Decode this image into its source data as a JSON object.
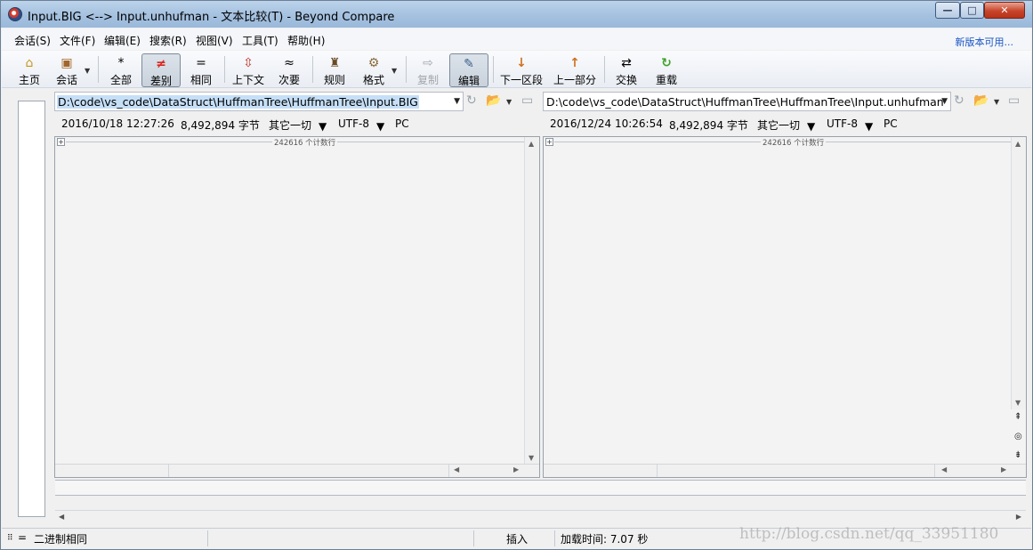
{
  "window": {
    "title": "Input.BIG <--> Input.unhufman - 文本比较(T) - Beyond Compare",
    "buttons": {
      "minimize": "—",
      "maximize": "□",
      "close": "✕"
    }
  },
  "menu": {
    "items": [
      "会话(S)",
      "文件(F)",
      "编辑(E)",
      "搜索(R)",
      "视图(V)",
      "工具(T)",
      "帮助(H)"
    ],
    "new_version": "新版本可用..."
  },
  "toolbar": {
    "home": "主页",
    "session": "会话",
    "all": "全部",
    "diff": "差别",
    "same": "相同",
    "context": "上下文",
    "minor": "次要",
    "rules": "规则",
    "format": "格式",
    "copy": "复制",
    "edit": "编辑",
    "next_section": "下一区段",
    "prev_section": "上一部分",
    "swap": "交换",
    "reload": "重载"
  },
  "left": {
    "path": "D:\\code\\vs_code\\DataStruct\\HuffmanTree\\HuffmanTree\\Input.BIG",
    "date": "2016/10/18 12:27:26",
    "size": "8,492,894 字节",
    "filter": "其它一切",
    "encoding": "UTF-8",
    "line_end": "PC",
    "header": "242616 个计数行"
  },
  "right": {
    "path": "D:\\code\\vs_code\\DataStruct\\HuffmanTree\\HuffmanTree\\Input.unhufman",
    "date": "2016/12/24 10:26:54",
    "size": "8,492,894 字节",
    "filter": "其它一切",
    "encoding": "UTF-8",
    "line_end": "PC",
    "header": "242616 个计数行"
  },
  "status": {
    "icon_text": "=",
    "binary_same": "二进制相同",
    "insert": "插入",
    "load_time": "加载时间: 7.07 秒"
  },
  "watermark": "http://blog.csdn.net/qq_33951180",
  "colors": {
    "accent": "#1a55c4",
    "selection": "#c5dff7"
  }
}
